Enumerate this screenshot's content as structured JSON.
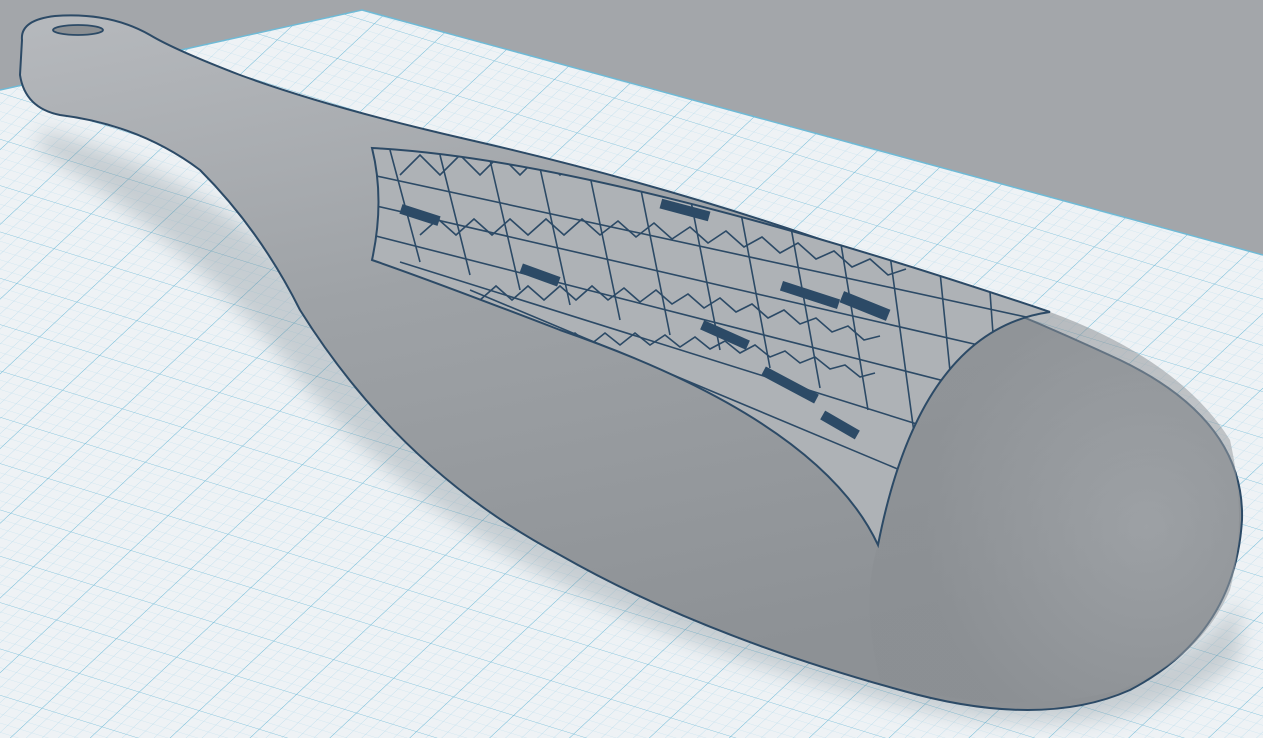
{
  "workspace": {
    "background_color": "#a3a6aa",
    "workplane_color": "#eef2f5",
    "grid_minor_color": "#b4dbec",
    "grid_major_color": "#6fbad6",
    "object_fill_color": "#9da1a5",
    "object_outline_color": "#2c4a66",
    "engraving_color": "#2c4a66"
  },
  "object": {
    "icon": "paddle-shape-icon",
    "pattern": "tribal-engraving"
  }
}
